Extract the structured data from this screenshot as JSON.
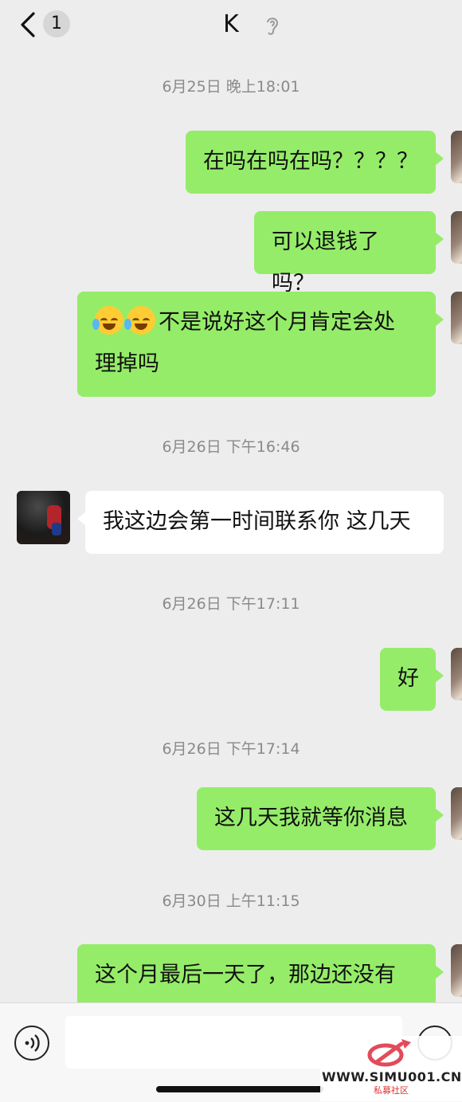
{
  "header": {
    "unread_count": "1",
    "contact_name": "K",
    "icons": {
      "back": "chevron-left-icon",
      "earpiece": "ear-icon"
    }
  },
  "messages": [
    {
      "type": "time",
      "text": "6月25日 晚上18:01"
    },
    {
      "type": "out",
      "text": "在吗在吗在吗？？？？"
    },
    {
      "type": "out",
      "text": "可以退钱了吗？"
    },
    {
      "type": "out",
      "emoji": [
        "face-with-tears-of-joy-icon",
        "face-with-tears-of-joy-icon"
      ],
      "line1": "不是说好这个月肯定会处",
      "line2": "理掉吗"
    },
    {
      "type": "time",
      "text": "6月26日 下午16:46"
    },
    {
      "type": "in",
      "text": "我这边会第一时间联系你 这几天"
    },
    {
      "type": "time",
      "text": "6月26日 下午17:11"
    },
    {
      "type": "out",
      "text": "好"
    },
    {
      "type": "time",
      "text": "6月26日 下午17:14"
    },
    {
      "type": "out",
      "text": "这几天我就等你消息"
    },
    {
      "type": "time",
      "text": "6月30日 上午11:15"
    },
    {
      "type": "out",
      "text": "这个月最后一天了，那边还没有"
    }
  ],
  "input_bar": {
    "icons": {
      "voice": "voice-icon",
      "emoji": "emoji-icon"
    }
  },
  "watermark": {
    "url": "WWW.SIMU001.CN",
    "subtitle": "私募社区"
  },
  "colors": {
    "background": "#ededed",
    "outgoing_bubble": "#95ec69",
    "incoming_bubble": "#ffffff",
    "timestamp": "#8a8a8a"
  }
}
